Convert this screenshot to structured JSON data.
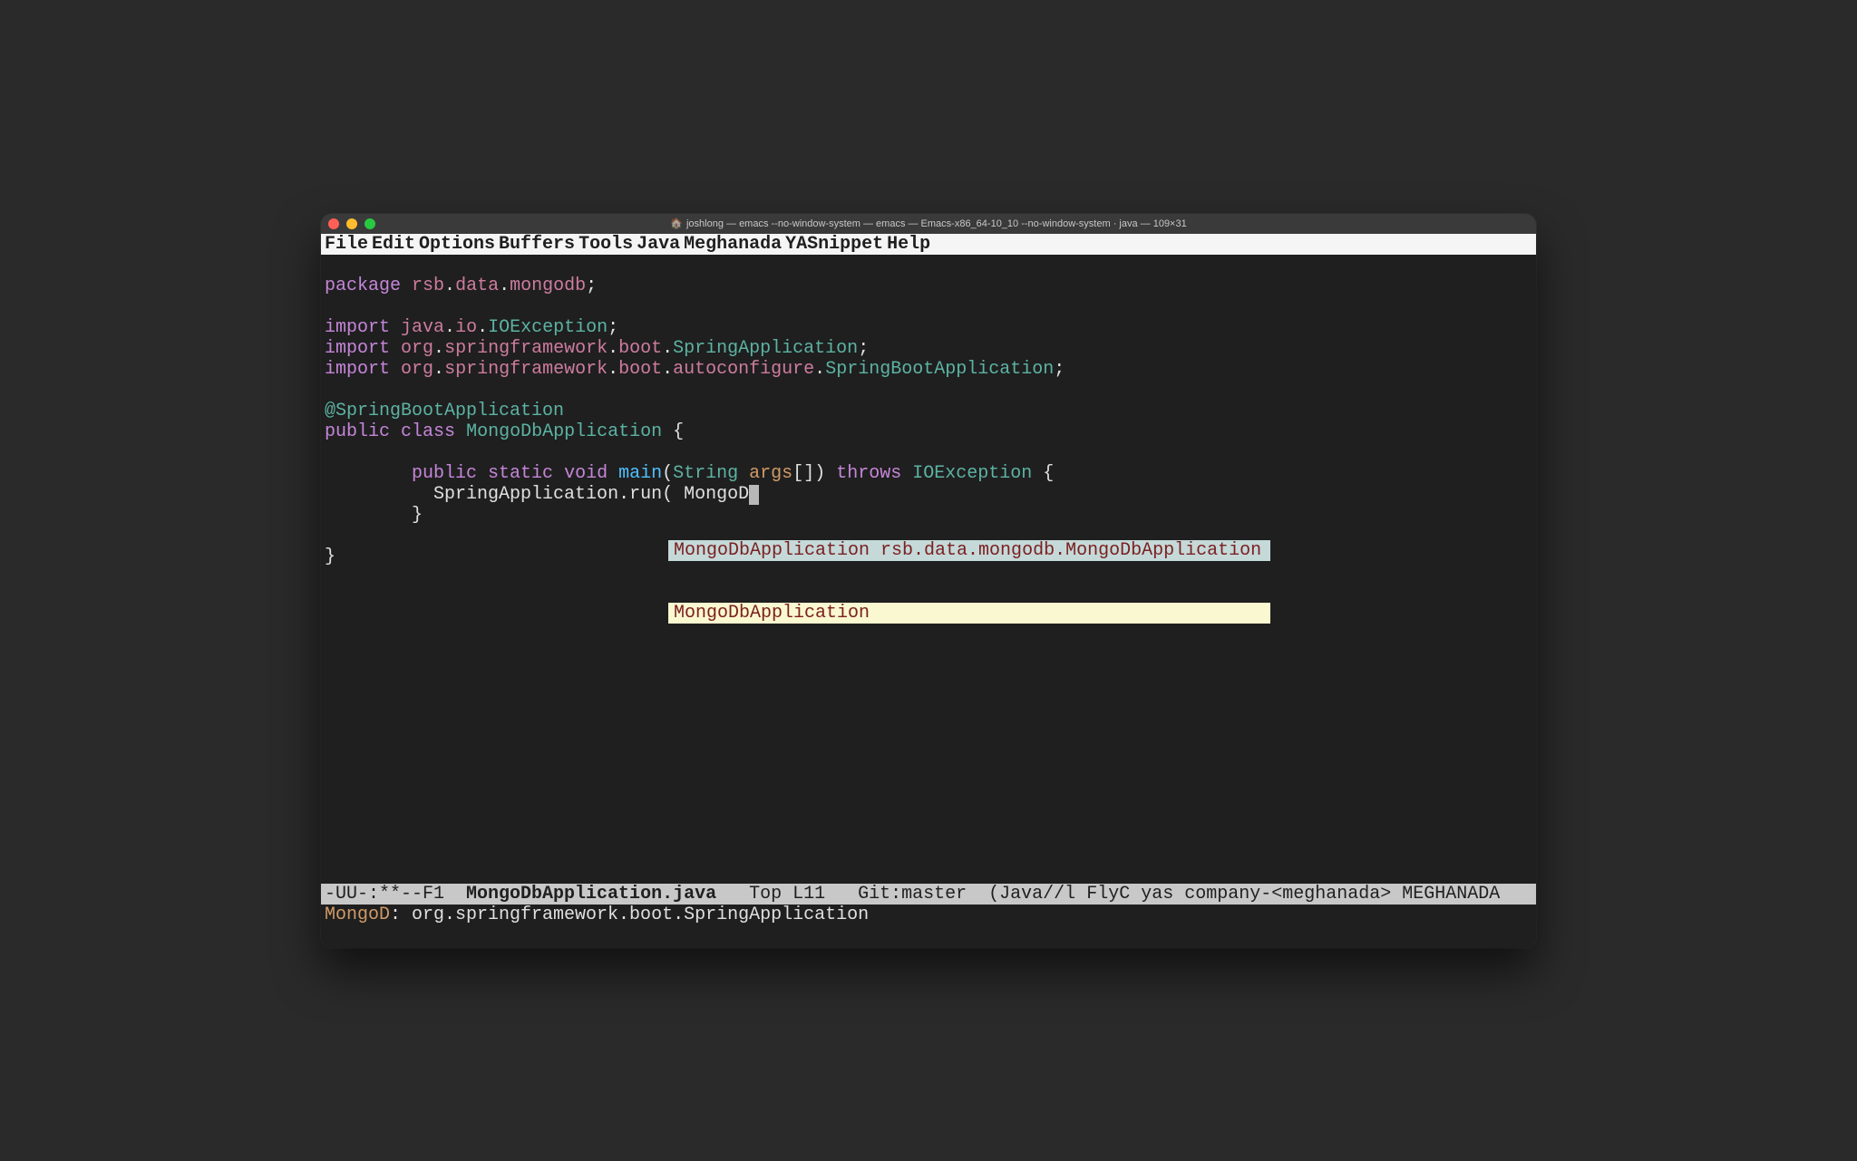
{
  "titlebar": {
    "title": "joshlong — emacs --no-window-system — emacs — Emacs-x86_64-10_10 --no-window-system · java — 109×31"
  },
  "menubar": {
    "items": [
      "File",
      "Edit",
      "Options",
      "Buffers",
      "Tools",
      "Java",
      "Meghanada",
      "YASnippet",
      "Help"
    ]
  },
  "code": {
    "package_kw": "package",
    "package_path1": "rsb",
    "package_path2": "data",
    "package_path3": "mongodb",
    "import_kw": "import",
    "imp1_p1": "java",
    "imp1_p2": "io",
    "imp1_p3": "IOException",
    "imp2_p1": "org",
    "imp2_p2": "springframework",
    "imp2_p3": "boot",
    "imp2_p4": "SpringApplication",
    "imp3_p1": "org",
    "imp3_p2": "springframework",
    "imp3_p3": "boot",
    "imp3_p4": "autoconfigure",
    "imp3_p5": "SpringBootApplication",
    "annotation": "@SpringBootApplication",
    "public_kw": "public",
    "class_kw": "class",
    "class_name": "MongoDbApplication",
    "static_kw": "static",
    "void_kw": "void",
    "main_name": "main",
    "string_type": "String",
    "args_name": "args",
    "throws_kw": "throws",
    "io_exception": "IOException",
    "spring_app_run": "SpringApplication.run( MongoD",
    "brace_open": "{",
    "brace_close": "}"
  },
  "completion": {
    "items": [
      {
        "text": "MongoDbApplication rsb.data.mongodb.MongoDbApplication",
        "selected": true
      },
      {
        "text": "MongoDbApplication",
        "selected": false
      }
    ]
  },
  "modeline": {
    "prefix": "-UU-:**--F1  ",
    "buffer_name": "MongoDbApplication.java",
    "gap1": "   ",
    "position": "Top L11",
    "gap2": "   ",
    "vcs": "Git:master",
    "gap3": "  ",
    "modes": "(Java//l FlyC yas company-<meghanada> MEGHANADA "
  },
  "echo": {
    "prefix": "MongoD",
    "rest": ": org.springframework.boot.SpringApplication"
  }
}
